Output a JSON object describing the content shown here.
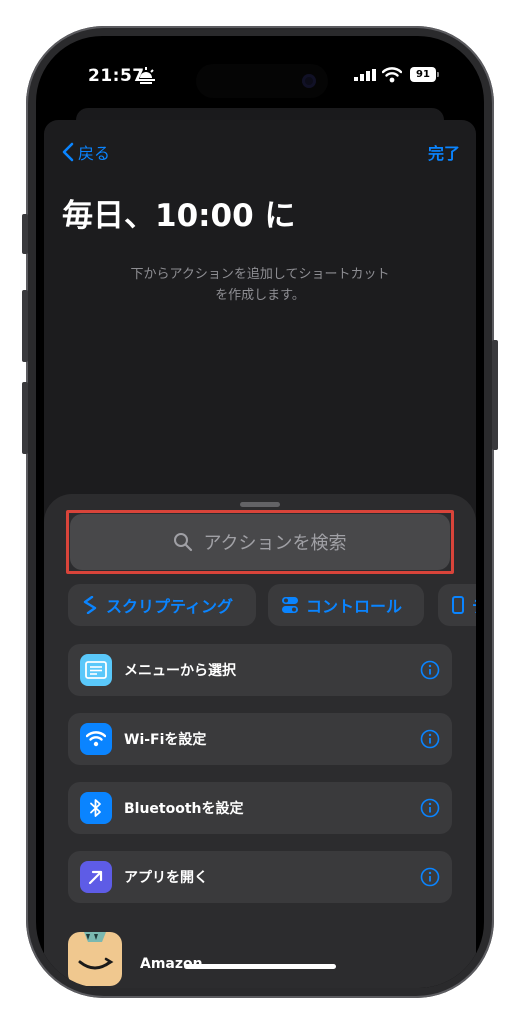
{
  "status_bar": {
    "time": "21:57",
    "battery": "91"
  },
  "nav": {
    "back_label": "戻る",
    "done_label": "完了"
  },
  "page": {
    "title": "毎日、10:00 に",
    "hint_line1": "下からアクションを追加してショートカット",
    "hint_line2": "を作成します。"
  },
  "search": {
    "placeholder": "アクションを検索"
  },
  "chips": [
    {
      "label": "スクリプティング",
      "icon": "scripting-icon"
    },
    {
      "label": "コントロール",
      "icon": "toggle-icon"
    },
    {
      "label": "デ",
      "icon": "device-icon"
    }
  ],
  "actions": [
    {
      "label": "メニューから選択",
      "icon": "menu-list-icon",
      "color": "#5ac8fa"
    },
    {
      "label": "Wi-Fiを設定",
      "icon": "wifi-icon",
      "color": "#0a84ff"
    },
    {
      "label": "Bluetoothを設定",
      "icon": "bluetooth-icon",
      "color": "#0a84ff"
    },
    {
      "label": "アプリを開く",
      "icon": "open-app-arrow-icon",
      "color": "#5e5ce6"
    }
  ],
  "app_section": {
    "label": "Amazon"
  },
  "colors": {
    "accent": "#0a84ff",
    "highlight": "#d9443a"
  }
}
